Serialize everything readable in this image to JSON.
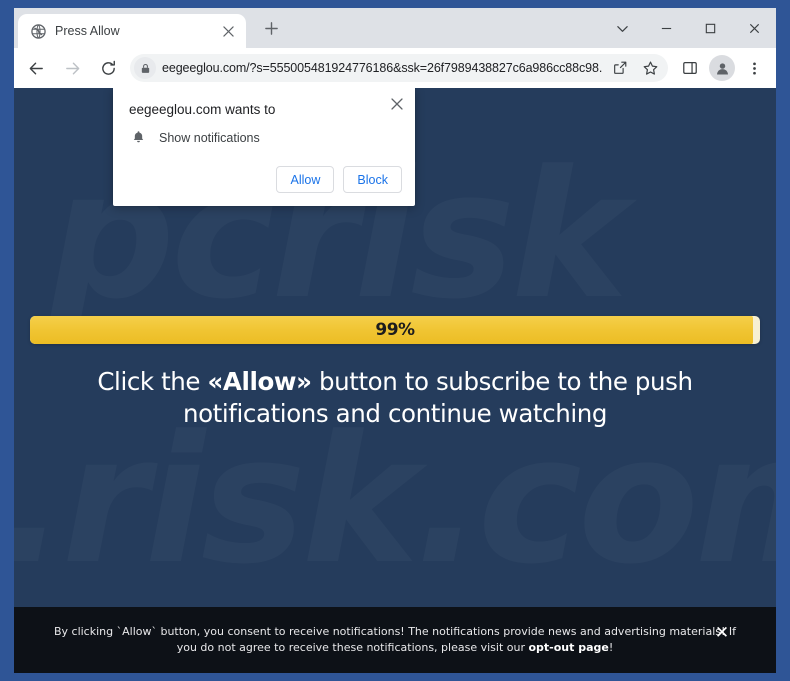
{
  "browser": {
    "tab": {
      "title": "Press Allow",
      "favicon_icon": "globe-icon",
      "close_icon": "close-icon"
    },
    "new_tab_icon": "plus-icon",
    "window_controls": {
      "tab_search_icon": "chevron-down-icon",
      "minimize_icon": "minimize-icon",
      "maximize_icon": "maximize-icon",
      "close_icon": "close-icon"
    },
    "toolbar": {
      "back_icon": "back-arrow-icon",
      "forward_icon": "forward-arrow-icon",
      "reload_icon": "reload-icon",
      "lock_icon": "lock-icon",
      "url": "eegeeglou.com/?s=555005481924776186&ssk=26f7989438827c6a986cc88c98...",
      "share_icon": "share-icon",
      "bookmark_icon": "star-icon",
      "side_panel_icon": "side-panel-icon",
      "profile_icon": "profile-avatar-icon",
      "menu_icon": "three-dot-menu-icon"
    }
  },
  "permission_dialog": {
    "title": "eegeeglou.com wants to",
    "permission_icon": "bell-icon",
    "permission_label": "Show notifications",
    "allow_label": "Allow",
    "block_label": "Block",
    "close_icon": "close-icon"
  },
  "page": {
    "background_color": "#253c5c",
    "watermark_line1": "pcrisk",
    "watermark_line2": ".risk.com",
    "progress": {
      "percent": 99,
      "label": "99%",
      "fill_color": "#f0c431",
      "track_color": "#f7f0d2"
    },
    "headline": {
      "part1": "Click the ",
      "emphasis": "«Allow»",
      "part2": " button to subscribe to the push notifications and continue watching"
    },
    "consent_banner": {
      "text_before_link": "By clicking `Allow` button, you consent to receive notifications! The notifications provide news and advertising materials! If you do not agree to receive these notifications, please visit our ",
      "link_label": "opt-out page",
      "text_after_link": "!",
      "close_icon": "close-icon",
      "background_color": "#0d1117"
    }
  }
}
